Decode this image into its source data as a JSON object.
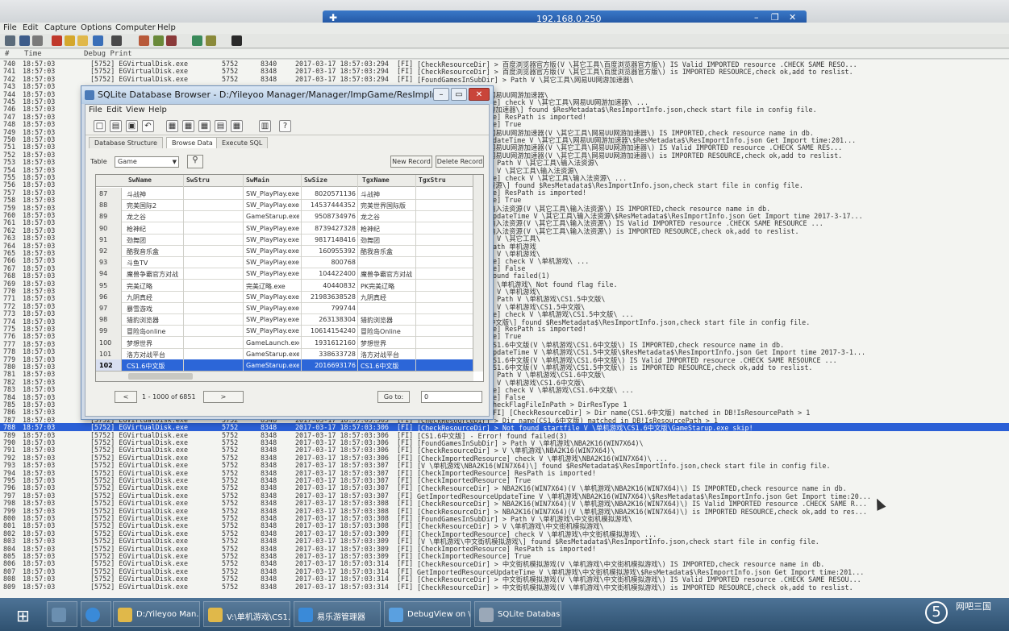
{
  "remote": {
    "host": "192.168.0.250"
  },
  "debugview": {
    "menu": [
      "File",
      "Edit",
      "Capture",
      "Options",
      "Computer",
      "Help"
    ],
    "columns": {
      "num": "#",
      "time": "Time",
      "print": "Debug Print"
    },
    "top_rows": [
      {
        "n": "740",
        "t": "18:57:03",
        "proc": "[5752] EGVirtualDisk.exe",
        "pid": "5752",
        "tid": "8340",
        "ts": "2017-03-17 18:57:03:294",
        "lvl": "[FI]",
        "msg": "[CheckResourceDir] > 百度浏览器官方版(V \\其它工具\\百度浏览器官方版\\) IS Valid IMPORTED resource .CHECK SAME RESO..."
      },
      {
        "n": "741",
        "t": "18:57:03",
        "proc": "[5752] EGVirtualDisk.exe",
        "pid": "5752",
        "tid": "8348",
        "ts": "2017-03-17 18:57:03:294",
        "lvl": "[FI]",
        "msg": "[CheckResourceDir] > 百度浏览器官方版(V \\其它工具\\百度浏览器官方版\\) is IMPORTED RESOURCE,check ok,add to reslist."
      },
      {
        "n": "742",
        "t": "18:57:03",
        "proc": "[5752] EGVirtualDisk.exe",
        "pid": "5752",
        "tid": "8348",
        "ts": "2017-03-17 18:57:03:294",
        "lvl": "[FI]",
        "msg": "[FoundGamesInSubDir] > Path V \\其它工具\\网易UU网游加速器\\"
      }
    ],
    "side_rows": [
      {
        "n": "743",
        "msg": ""
      },
      {
        "n": "744",
        "msg": "网易UU网游加速器\\"
      },
      {
        "n": "745",
        "msg": "ce] check V \\其它工具\\网易UU网游加速器\\ ..."
      },
      {
        "n": "746",
        "msg": "游加速器\\] found $ResMetadata$\\ResImportInfo.json,check start file in config file."
      },
      {
        "n": "747",
        "msg": "ce] ResPath is imported!"
      },
      {
        "n": "748",
        "msg": "ce] True"
      },
      {
        "n": "749",
        "msg": "网易UU网游加速器(V \\其它工具\\网易UU网游加速器\\) IS IMPORTED,check resource name in db."
      },
      {
        "n": "750",
        "msg": "pdateTime V \\其它工具\\网易UU网游加速器\\$ResMetadata$\\ResImportInfo.json Get Import time:201..."
      },
      {
        "n": "751",
        "msg": "网易UU网游加速器(V \\其它工具\\网易UU网游加速器\\) IS Valid IMPORTED resource .CHECK SAME RES..."
      },
      {
        "n": "752",
        "msg": "网易UU网游加速器(V \\其它工具\\网易UU网游加速器\\) is IMPORTED RESOURCE,check ok,add to reslist."
      },
      {
        "n": "753",
        "msg": "> Path V \\其它工具\\输入法资源\\"
      },
      {
        "n": "754",
        "msg": "> V \\其它工具\\输入法资源\\"
      },
      {
        "n": "755",
        "msg": "ce] check V \\其它工具\\输入法资源\\ ..."
      },
      {
        "n": "756",
        "msg": "资源\\] found $ResMetadata$\\ResImportInfo.json,check start file in config file."
      },
      {
        "n": "757",
        "msg": "ce] ResPath is imported!"
      },
      {
        "n": "758",
        "msg": "ce] True"
      },
      {
        "n": "759",
        "msg": "输入法资源(V \\其它工具\\输入法资源\\) IS IMPORTED,check resource name in db."
      },
      {
        "n": "760",
        "msg": "UpdateTime V \\其它工具\\输入法资源\\$ResMetadata$\\ResImportInfo.json Get Import time 2017-3-17..."
      },
      {
        "n": "761",
        "msg": "输入法资源(V \\其它工具\\输入法资源\\) IS Valid IMPORTED resource .CHECK SAME RESOURCE ..."
      },
      {
        "n": "762",
        "msg": "输入法资源(V \\其它工具\\输入法资源\\) is IMPORTED RESOURCE,check ok,add to reslist."
      },
      {
        "n": "763",
        "msg": ". V \\其它工具\\"
      },
      {
        "n": "764",
        "msg": "Path 单机游戏"
      },
      {
        "n": "765",
        "msg": "> V \\单机游戏\\"
      },
      {
        "n": "766",
        "msg": "ce] check V \\单机游戏\\ ..."
      },
      {
        "n": "767",
        "msg": "ce] False"
      },
      {
        "n": "768",
        "msg": "found failed(1)"
      },
      {
        "n": "769",
        "msg": "V \\单机游戏\\ Not found flag file."
      },
      {
        "n": "770",
        "msg": "> V \\单机游戏\\"
      },
      {
        "n": "771",
        "msg": "> Path V \\单机游戏\\CS1.5中文版\\"
      },
      {
        "n": "772",
        "msg": "> V \\单机游戏\\CS1.5中文版\\"
      },
      {
        "n": "773",
        "msg": "ce] check V \\单机游戏\\CS1.5中文版\\ ..."
      },
      {
        "n": "774",
        "msg": "中文版\\] found $ResMetadata$\\ResImportInfo.json,check start file in config file."
      },
      {
        "n": "775",
        "msg": "ce] ResPath is imported!"
      },
      {
        "n": "776",
        "msg": "ce] True"
      },
      {
        "n": "777",
        "msg": "CS1.6中文版(V \\单机游戏\\CS1.6中文版\\) IS IMPORTED,check resource name in db."
      },
      {
        "n": "778",
        "msg": "UpdateTime V \\单机游戏\\CS1.5中文版\\$ResMetadata$\\ResImportInfo.json Get Import time 2017-3-1..."
      },
      {
        "n": "779",
        "msg": "CS1.6中文版(V \\单机游戏\\CS1.6中文版\\) IS Valid IMPORTED resource .CHECK SAME RESOURCE ..."
      },
      {
        "n": "780",
        "msg": "CS1.6中文版(V \\单机游戏\\CS1.5中文版\\) is IMPORTED RESOURCE,check ok,add to reslist."
      },
      {
        "n": "781",
        "msg": "> Path V \\单机游戏\\CS1.6中文版\\"
      },
      {
        "n": "782",
        "msg": "> V \\单机游戏\\CS1.6中文版\\"
      },
      {
        "n": "783",
        "msg": "ce] check V \\单机游戏\\CS1.6中文版\\ ..."
      },
      {
        "n": "784",
        "msg": "ce] False"
      },
      {
        "n": "785",
        "msg": "CheckFlagFileInPath > DirResType 1"
      },
      {
        "n": "786",
        "msg": "[FI] [CheckResourceDir] > Dir name(CS1.6中文版) matched in DB!IsResourcePath > 1"
      }
    ],
    "selected_row": {
      "n": "788",
      "t": "18:57:03",
      "proc": "[5752] EGVirtualDisk.exe",
      "pid": "5752",
      "tid": "8348",
      "ts": "2017-03-17 18:57:03:306",
      "lvl": "[FI]",
      "msg": "[CheckResourceDir] > Not found startfile V \\单机游戏\\CS1.6中文版\\GameStarup.exe skip!"
    },
    "bottom_rows": [
      {
        "n": "787",
        "ts": "2017-03-17 18:57:03:305",
        "msg": "[CheckResourceDir] > Dir name(CS1.6中文版) matched in DB!IsResourcePath > 1"
      },
      {
        "n": "789",
        "ts": "2017-03-17 18:57:03:306",
        "msg": "[CS1.6中文版] - Error! found failed(3)"
      },
      {
        "n": "790",
        "ts": "2017-03-17 18:57:03:306",
        "msg": "[FoundGamesInSubDir] > Path V \\单机游戏\\NBA2K16(WIN7X64)\\"
      },
      {
        "n": "791",
        "ts": "2017-03-17 18:57:03:306",
        "msg": "[CheckResourceDir] > V \\单机游戏\\NBA2K16(WIN7X64)\\"
      },
      {
        "n": "792",
        "ts": "2017-03-17 18:57:03:306",
        "msg": "[CheckImportedResource] check V \\单机游戏\\NBA2K16(WIN7X64)\\ ..."
      },
      {
        "n": "793",
        "ts": "2017-03-17 18:57:03:307",
        "msg": "[V \\单机游戏\\NBA2K16(WIN7X64)\\] found $ResMetadata$\\ResImportInfo.json,check start file in config file."
      },
      {
        "n": "794",
        "ts": "2017-03-17 18:57:03:307",
        "msg": "[CheckImportedResource] ResPath is imported!"
      },
      {
        "n": "795",
        "ts": "2017-03-17 18:57:03:307",
        "msg": "[CheckImportedResource] True"
      },
      {
        "n": "796",
        "ts": "2017-03-17 18:57:03:307",
        "msg": "[CheckResourceDir] > NBA2K16(WIN7X64)(V \\单机游戏\\NBA2K16(WIN7X64)\\) IS IMPORTED,check resource name in db."
      },
      {
        "n": "797",
        "ts": "2017-03-17 18:57:03:307",
        "msg": "GetImportedResourceUpdateTime V \\单机游戏\\NBA2K16(WIN7X64)\\$ResMetadata$\\ResImportInfo.json Get Import time:20..."
      },
      {
        "n": "798",
        "ts": "2017-03-17 18:57:03:308",
        "msg": "[CheckResourceDir] > NBA2K16(WIN7X64)(V \\单机游戏\\NBA2K16(WIN7X64)\\) IS Valid IMPORTED resource .CHECK SAME R..."
      },
      {
        "n": "799",
        "ts": "2017-03-17 18:57:03:308",
        "msg": "[CheckResourceDir] > NBA2K16(WIN7X64)(V \\单机游戏\\NBA2K16(WIN7X64)\\) is IMPORTED RESOURCE,check ok,add to res..."
      },
      {
        "n": "800",
        "ts": "2017-03-17 18:57:03:308",
        "msg": "[FoundGamesInSubDir] > Path V \\单机游戏\\中文街机模拟游戏\\"
      },
      {
        "n": "801",
        "ts": "2017-03-17 18:57:03:308",
        "msg": "[CheckResourceDir] > V \\单机游戏\\中文街机模拟游戏\\"
      },
      {
        "n": "802",
        "ts": "2017-03-17 18:57:03:309",
        "msg": "[CheckImportedResource] check V \\单机游戏\\中文街机模拟游戏\\ ..."
      },
      {
        "n": "803",
        "ts": "2017-03-17 18:57:03:309",
        "msg": "[V \\单机游戏\\中文街机模拟游戏\\] found $ResMetadata$\\ResImportInfo.json,check start file in config file."
      },
      {
        "n": "804",
        "ts": "2017-03-17 18:57:03:309",
        "msg": "[CheckImportedResource] ResPath is imported!"
      },
      {
        "n": "805",
        "ts": "2017-03-17 18:57:03:309",
        "msg": "[CheckImportedResource] True"
      },
      {
        "n": "806",
        "ts": "2017-03-17 18:57:03:314",
        "msg": "[CheckResourceDir] > 中文街机模拟游戏(V \\单机游戏\\中文街机模拟游戏\\) IS IMPORTED,check resource name in db."
      },
      {
        "n": "807",
        "ts": "2017-03-17 18:57:03:314",
        "msg": "GetImportedResourceUpdateTime V \\单机游戏\\中文街机模拟游戏\\$ResMetadata$\\ResImportInfo.json Get Import time:201..."
      },
      {
        "n": "808",
        "ts": "2017-03-17 18:57:03:314",
        "msg": "[CheckResourceDir] > 中文街机模拟游戏(V \\单机游戏\\中文街机模拟游戏\\) IS Valid IMPORTED resource .CHECK SAME RESOU..."
      },
      {
        "n": "809",
        "ts": "2017-03-17 18:57:03:314",
        "msg": "[CheckResourceDir] > 中文街机模拟游戏(V \\单机游戏\\中文街机模拟游戏\\) is IMPORTED RESOURCE,check ok,add to reslist."
      }
    ],
    "row_time": "18:57:03",
    "row_proc": "[5752] EGVirtualDisk.exe",
    "row_pid": "5752",
    "row_tid": "8348",
    "row_lvl": "[FI]"
  },
  "sqlite": {
    "title": "SQLite Database Browser - D:/Yileyoo Manager/Manager/ImpGame/ResImpInf...",
    "menu": [
      "File",
      "Edit",
      "View",
      "Help"
    ],
    "tabs": [
      "Database Structure",
      "Browse Data",
      "Execute SQL"
    ],
    "table_label": "Table",
    "table_value": "Game",
    "new_record": "New Record",
    "delete_record": "Delete Record",
    "columns": [
      "SwName",
      "SwStru",
      "SwMain",
      "SwSize",
      "TgxName",
      "TgxStru"
    ],
    "rows": [
      {
        "idx": "87",
        "name": "斗战神",
        "stru": "",
        "main": "SW_PlayPlay.exe",
        "size": "8020571136",
        "tgx": "斗战神"
      },
      {
        "idx": "88",
        "name": "完美国际2",
        "stru": "",
        "main": "SW_PlayPlay.exe",
        "size": "14537444352",
        "tgx": "完美世界国际版"
      },
      {
        "idx": "89",
        "name": "龙之谷",
        "stru": "",
        "main": "GameStarup.exe",
        "size": "9508734976",
        "tgx": "龙之谷"
      },
      {
        "idx": "90",
        "name": "枪神纪",
        "stru": "",
        "main": "SW_PlayPlay.exe",
        "size": "8739427328",
        "tgx": "枪神纪"
      },
      {
        "idx": "91",
        "name": "劲舞团",
        "stru": "",
        "main": "SW_PlayPlay.exe",
        "size": "9817148416",
        "tgx": "劲舞团"
      },
      {
        "idx": "92",
        "name": "酷我音乐盒",
        "stru": "",
        "main": "SW_PlayPlay.exe",
        "size": "160955392",
        "tgx": "酷我音乐盒"
      },
      {
        "idx": "93",
        "name": "斗鱼TV",
        "stru": "",
        "main": "SW_PlayPlay.exe",
        "size": "800768",
        "tgx": ""
      },
      {
        "idx": "94",
        "name": "魔兽争霸官方对战",
        "stru": "",
        "main": "SW_PlayPlay.exe",
        "size": "104422400",
        "tgx": "魔兽争霸官方对战"
      },
      {
        "idx": "95",
        "name": "完美辽略",
        "stru": "",
        "main": "完美辽略.exe",
        "size": "40440832",
        "tgx": "PK完美辽略"
      },
      {
        "idx": "96",
        "name": "九阴真经",
        "stru": "",
        "main": "SW_PlayPlay.exe",
        "size": "21983638528",
        "tgx": "九阴真经"
      },
      {
        "idx": "97",
        "name": "暴雪游戏",
        "stru": "",
        "main": "SW_PlayPlay.exe",
        "size": "799744",
        "tgx": ""
      },
      {
        "idx": "98",
        "name": "猎豹浏览器",
        "stru": "",
        "main": "SW_PlayPlay.exe",
        "size": "263138304",
        "tgx": "猎豹浏览器"
      },
      {
        "idx": "99",
        "name": "冒险岛online",
        "stru": "",
        "main": "SW_PlayPlay.exe",
        "size": "10614154240",
        "tgx": "冒险岛Online"
      },
      {
        "idx": "100",
        "name": "梦想世界",
        "stru": "",
        "main": "GameLaunch.exe",
        "size": "1931612160",
        "tgx": "梦想世界"
      },
      {
        "idx": "101",
        "name": "洛方对战平台",
        "stru": "",
        "main": "GameStarup.exe",
        "size": "338633728",
        "tgx": "洛方对战平台"
      },
      {
        "idx": "102",
        "name": "CS1.6中文版",
        "stru": "",
        "main": "GameStarup.exe",
        "size": "2016693176",
        "tgx": "CS1.6中文版",
        "selected": true
      }
    ],
    "pager_prev": "<",
    "pager_range": "1 - 1000 of 6851",
    "pager_next": ">",
    "goto_label": "Go to:",
    "goto_value": "0"
  },
  "taskbar": {
    "items": [
      {
        "label": "D:/Yileyoo Man...",
        "color": "#e0b84a"
      },
      {
        "label": "V:\\单机游戏\\CS1...",
        "color": "#e0b84a"
      },
      {
        "label": "易乐游管理器",
        "color": "#3a8ad8"
      },
      {
        "label": "DebugView on \\...",
        "color": "#5aa0e0"
      },
      {
        "label": "SQLite Databas...",
        "color": "#9aa8b8"
      }
    ]
  },
  "watermark": {
    "brand": "网吧三国",
    "glyph": "5"
  }
}
